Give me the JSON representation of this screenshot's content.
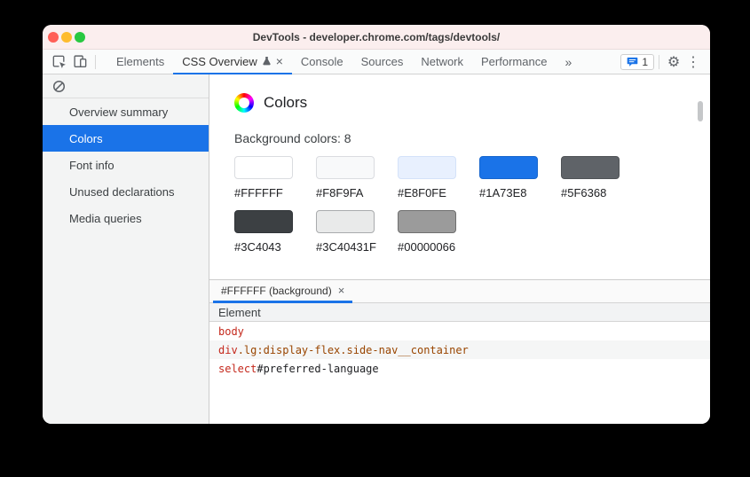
{
  "colors": {
    "accent_blue": "#1a73e8",
    "titlebar_bg": "#fbeeee",
    "traffic_red": "#ff5f57",
    "traffic_yellow": "#febc2e",
    "traffic_green": "#28c840",
    "token_tag": "#c4281c",
    "token_class": "#994500"
  },
  "icons": {
    "more_tabs": "»",
    "settings": "⚙",
    "menu": "⋮",
    "close": "×"
  },
  "window": {
    "title": "DevTools - developer.chrome.com/tags/devtools/"
  },
  "toolbar": {
    "tabs": [
      {
        "label": "Elements",
        "active": false
      },
      {
        "label": "CSS Overview",
        "active": true,
        "closable": true
      },
      {
        "label": "Console",
        "active": false
      },
      {
        "label": "Sources",
        "active": false
      },
      {
        "label": "Network",
        "active": false
      },
      {
        "label": "Performance",
        "active": false
      }
    ],
    "issues_count": "1"
  },
  "sidebar": {
    "items": [
      {
        "label": "Overview summary",
        "active": false
      },
      {
        "label": "Colors",
        "active": true
      },
      {
        "label": "Font info",
        "active": false
      },
      {
        "label": "Unused declarations",
        "active": false
      },
      {
        "label": "Media queries",
        "active": false
      }
    ]
  },
  "main": {
    "title": "Colors",
    "subtitle": "Background colors: 8",
    "swatches": [
      {
        "hex": "#FFFFFF",
        "bg": "#ffffff",
        "border": "#dadce0"
      },
      {
        "hex": "#F8F9FA",
        "bg": "#f8f9fa",
        "border": "#dadce0"
      },
      {
        "hex": "#E8F0FE",
        "bg": "#e8f0fe",
        "border": "#d4e2f9"
      },
      {
        "hex": "#1A73E8",
        "bg": "#1a73e8",
        "border": "#1766cd"
      },
      {
        "hex": "#5F6368",
        "bg": "#5f6368",
        "border": "#505357"
      },
      {
        "hex": "#3C4043",
        "bg": "#3c4043",
        "border": "#313539"
      },
      {
        "hex": "#3C40431F",
        "bg": "#e9eaea",
        "border": "#a9abad"
      },
      {
        "hex": "#00000066",
        "bg": "#9b9b9b",
        "border": "#6f6f6f"
      }
    ],
    "detail": {
      "tab_label": "#FFFFFF (background)",
      "table_header": "Element",
      "rows": [
        {
          "tag": "body",
          "rest": ""
        },
        {
          "tag": "div",
          "rest": ".lg:display-flex.side-nav__container"
        },
        {
          "tag": "select",
          "rest": "#preferred-language"
        }
      ]
    }
  }
}
